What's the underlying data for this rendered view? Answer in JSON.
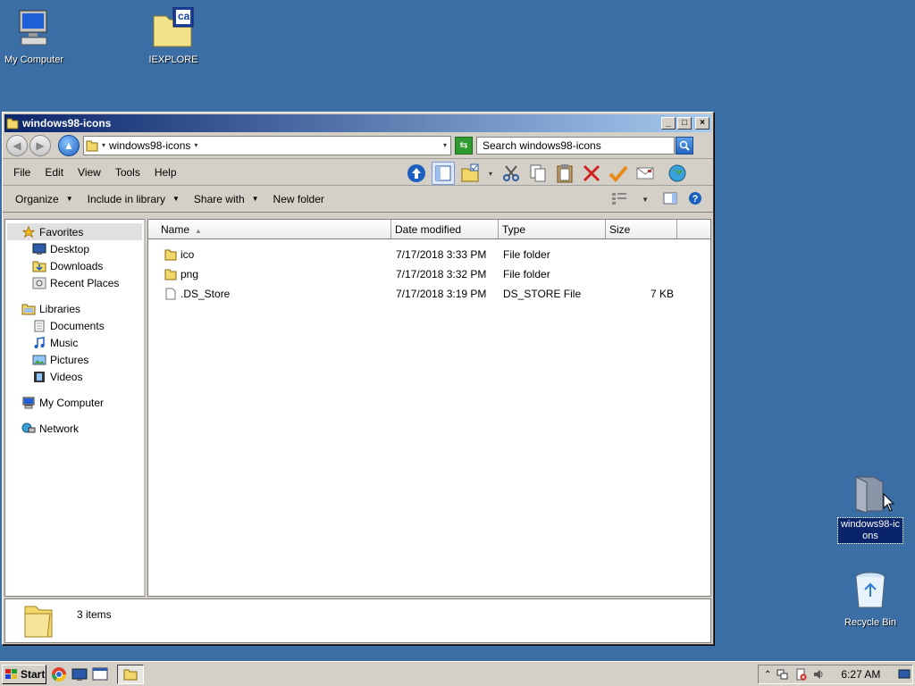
{
  "desktop": {
    "icons": [
      {
        "label": "My Computer"
      },
      {
        "label": "IEXPLORE",
        "badge": "ca"
      },
      {
        "label": "windows98-icons"
      },
      {
        "label": "Recycle Bin"
      }
    ]
  },
  "window": {
    "title": "windows98-icons",
    "controls": {
      "minimize": "_",
      "maximize": "□",
      "close": "×"
    },
    "address": {
      "path": "windows98-icons",
      "sep": "▾",
      "dropdown": "▾"
    },
    "search": {
      "placeholder": "Search windows98-icons"
    },
    "menu": [
      "File",
      "Edit",
      "View",
      "Tools",
      "Help"
    ],
    "commands": {
      "organize": "Organize",
      "include": "Include in library",
      "share": "Share with",
      "new_folder": "New folder"
    },
    "nav": {
      "favorites": "Favorites",
      "desktop": "Desktop",
      "downloads": "Downloads",
      "recent": "Recent Places",
      "libraries": "Libraries",
      "documents": "Documents",
      "music": "Music",
      "pictures": "Pictures",
      "videos": "Videos",
      "my_computer": "My Computer",
      "network": "Network"
    },
    "columns": {
      "name": "Name",
      "date": "Date modified",
      "type": "Type",
      "size": "Size"
    },
    "files": [
      {
        "name": "ico",
        "date": "7/17/2018 3:33 PM",
        "type": "File folder",
        "size": "",
        "icon": "folder-icon"
      },
      {
        "name": "png",
        "date": "7/17/2018 3:32 PM",
        "type": "File folder",
        "size": "",
        "icon": "folder-icon"
      },
      {
        "name": ".DS_Store",
        "date": "7/17/2018 3:19 PM",
        "type": "DS_STORE File",
        "size": "7 KB",
        "icon": "file-icon"
      }
    ],
    "status": {
      "items": "3 items"
    }
  },
  "taskbar": {
    "start": "Start",
    "clock": "6:27 AM"
  },
  "colors": {
    "desktop": "#3a6ea5",
    "title_start": "#0a246a",
    "title_end": "#a6caf0"
  }
}
